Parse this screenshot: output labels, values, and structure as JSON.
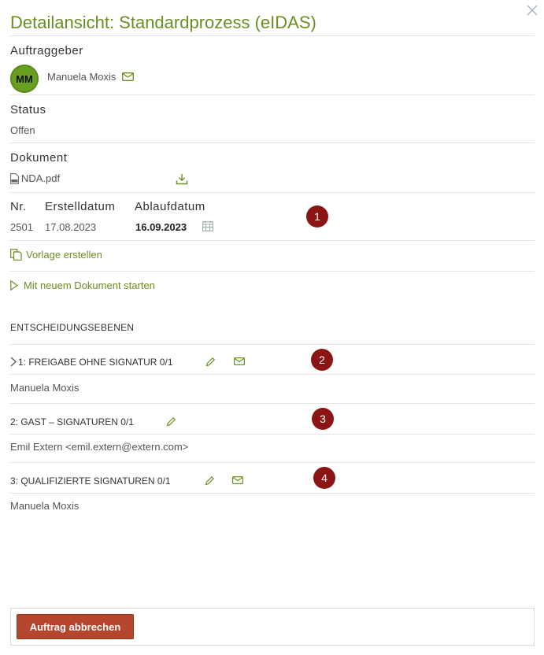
{
  "dialog": {
    "title": "Detailansicht: Standardprozess (eIDAS)"
  },
  "requester": {
    "label": "Auftraggeber",
    "initials": "MM",
    "name": "Manuela Moxis"
  },
  "status": {
    "label": "Status",
    "value": "Offen"
  },
  "document": {
    "label": "Dokument",
    "file_name": "NDA.pdf"
  },
  "meta": {
    "nr_label": "Nr.",
    "nr_value": "2501",
    "created_label": "Erstelldatum",
    "created_value": "17.08.2023",
    "expiry_label": "Ablaufdatum",
    "expiry_value": "16.09.2023"
  },
  "actions": {
    "create_template": "Vorlage erstellen",
    "start_new_document": "Mit neuem Dokument starten"
  },
  "levels": {
    "heading": "ENTSCHEIDUNGSEBENEN",
    "items": [
      {
        "title": "1: FREIGABE OHNE SIGNATUR 0/1",
        "member": "Manuela Moxis"
      },
      {
        "title": "2: GAST – SIGNATUREN 0/1",
        "member": "Emil Extern <emil.extern@extern.com>"
      },
      {
        "title": "3: QUALIFIZIERTE SIGNATUREN 0/1",
        "member": "Manuela Moxis"
      }
    ]
  },
  "markers": [
    "1",
    "2",
    "3",
    "4"
  ],
  "footer": {
    "cancel_label": "Auftrag abbrechen"
  },
  "colors": {
    "accent": "#6b8e23",
    "danger": "#b5452d",
    "marker": "#8b1414",
    "avatar": "#6aa022"
  },
  "icons": {
    "close": "close-icon",
    "mail": "mail-icon",
    "pdf": "pdf-file-icon",
    "download": "download-icon",
    "calendar": "calendar-icon",
    "template": "copy-template-icon",
    "play": "play-icon",
    "chevron": "chevron-right-icon",
    "edit": "pencil-icon"
  }
}
